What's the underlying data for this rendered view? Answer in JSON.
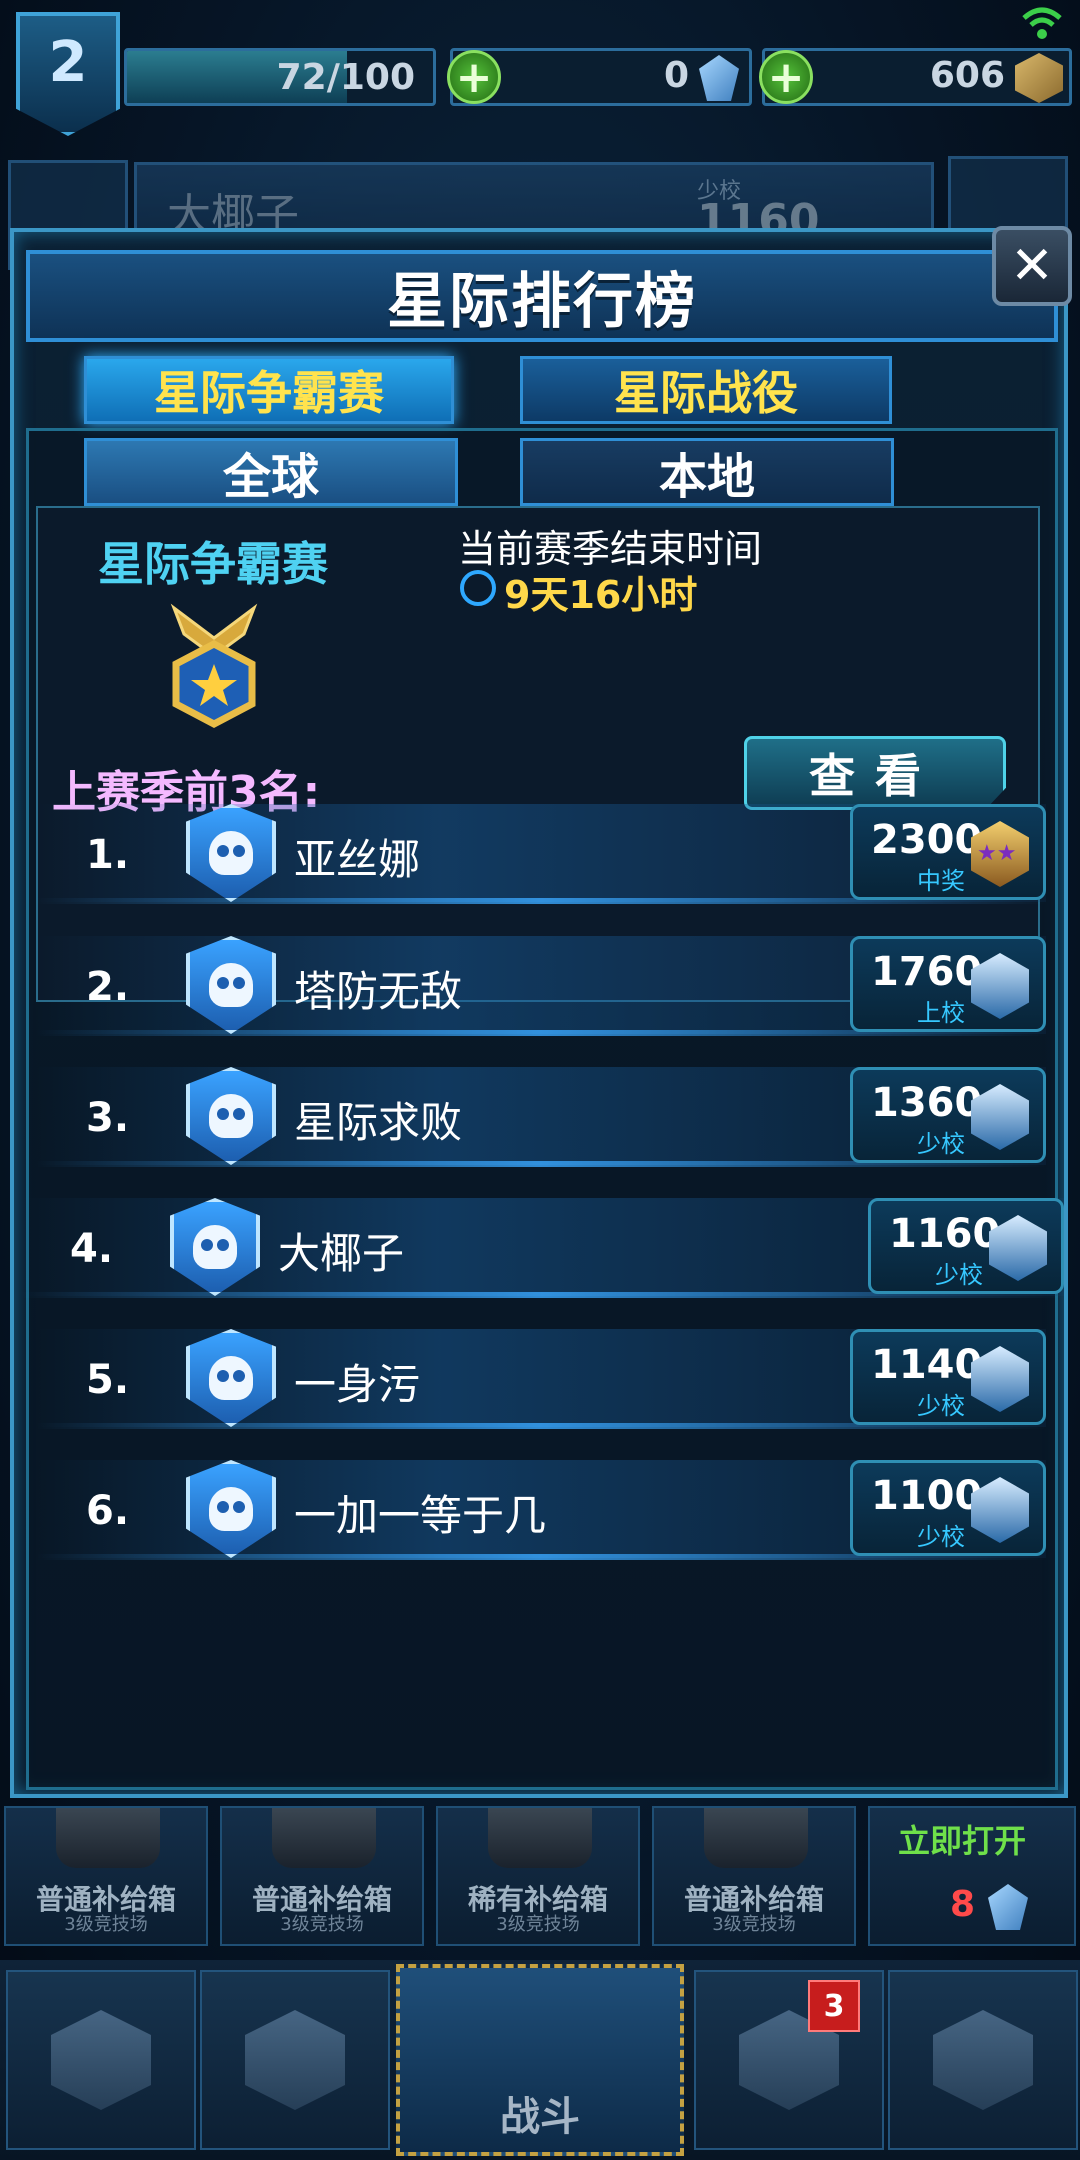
{
  "status_bar": {
    "level": "2",
    "xp_text": "72/100",
    "xp_fraction": 0.72,
    "crystals": "0",
    "coins": "606",
    "plus_symbol": "+"
  },
  "background_profile": {
    "name": "大椰子",
    "rank": "少校",
    "score": "1160"
  },
  "modal": {
    "title": "星际排行榜",
    "close_symbol": "✕",
    "tabs": [
      "星际争霸赛",
      "星际战役"
    ],
    "subtabs": [
      "全球",
      "本地"
    ],
    "info": {
      "title": "星际争霸赛",
      "season_end_label": "当前赛季结束时间",
      "season_end_value": "9天16小时",
      "last_top3_label": "上赛季前3名:",
      "view_button": "查看"
    },
    "rankings": [
      {
        "rank": "1.",
        "name": "亚丝娜",
        "score": "2300",
        "title": "中奖",
        "icon": "gold-star-rank-icon"
      },
      {
        "rank": "2.",
        "name": "塔防无敌",
        "score": "1760",
        "title": "上校",
        "icon": "blue-rank-icon"
      },
      {
        "rank": "3.",
        "name": "星际求败",
        "score": "1360",
        "title": "少校",
        "icon": "blue-rank-icon"
      },
      {
        "rank": "4.",
        "name": "大椰子",
        "score": "1160",
        "title": "少校",
        "icon": "blue-rank-icon"
      },
      {
        "rank": "5.",
        "name": "一身污",
        "score": "1140",
        "title": "少校",
        "icon": "blue-rank-icon"
      },
      {
        "rank": "6.",
        "name": "一加一等于几",
        "score": "1100",
        "title": "少校",
        "icon": "blue-rank-icon"
      }
    ]
  },
  "chests": [
    {
      "name": "普通补给箱",
      "sub": "3级竞技场"
    },
    {
      "name": "普通补给箱",
      "sub": "3级竞技场"
    },
    {
      "name": "稀有补给箱",
      "sub": "3级竞技场"
    },
    {
      "name": "普通补给箱",
      "sub": "3级竞技场"
    }
  ],
  "open_now": {
    "label": "立即打开",
    "cost": "8"
  },
  "bottom_nav": {
    "battle_label": "战斗",
    "social_badge": "3"
  },
  "colors": {
    "accent": "#2f8fd6",
    "tab_text": "#ffe34d",
    "top3_label": "#f4b9ff"
  }
}
